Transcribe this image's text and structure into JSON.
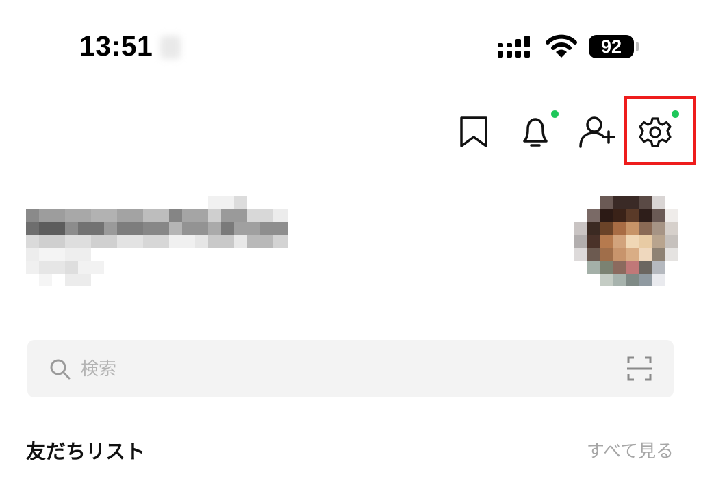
{
  "status_bar": {
    "time": "13:51",
    "battery_level": "92",
    "signal_icon": "cellular-signal-icon",
    "wifi_icon": "wifi-icon"
  },
  "header_icons": [
    {
      "name": "bookmark-icon",
      "badge": false
    },
    {
      "name": "bell-icon",
      "badge": true
    },
    {
      "name": "add-friend-icon",
      "badge": true
    },
    {
      "name": "gear-icon",
      "badge": true,
      "highlighted": true
    }
  ],
  "colors": {
    "badge_green": "#1ec75a",
    "highlight_red": "#ee1c1c",
    "search_bg": "#f3f3f3",
    "muted_text": "#a6a6a6"
  },
  "search": {
    "placeholder": "検索",
    "value": ""
  },
  "friends_section": {
    "title": "友だちリスト",
    "see_all": "すべて見る"
  }
}
